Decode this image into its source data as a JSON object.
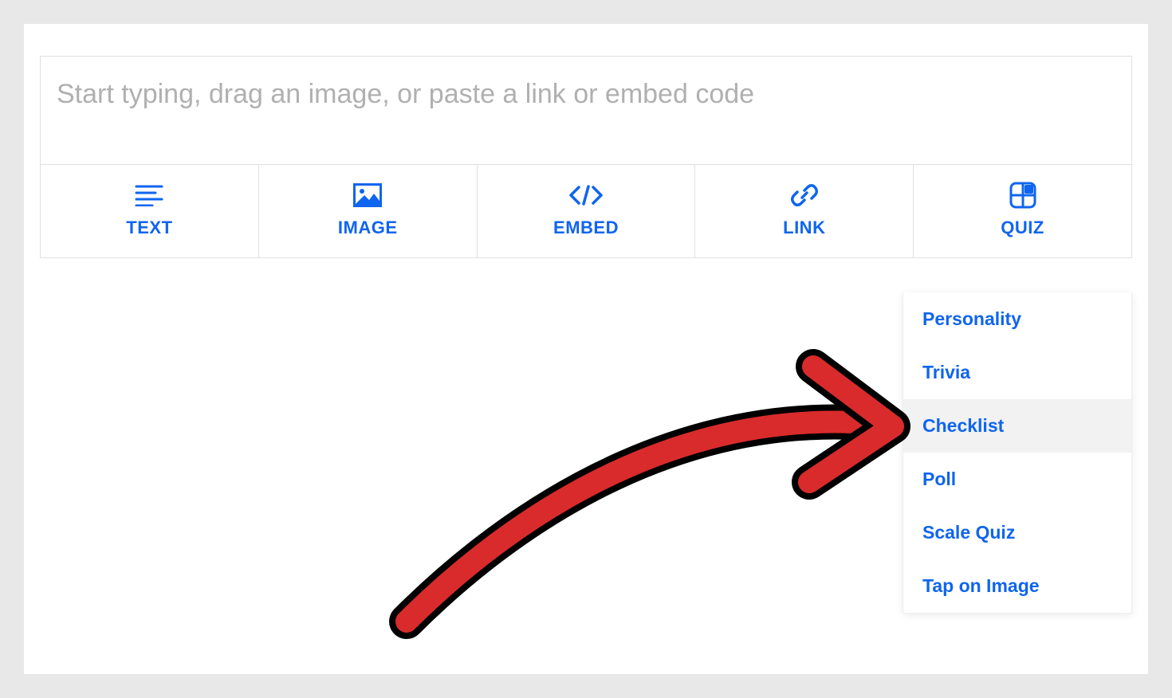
{
  "editor": {
    "placeholder": "Start typing, drag an image, or paste a link or embed code",
    "value": ""
  },
  "toolbar": {
    "text": {
      "label": "TEXT"
    },
    "image": {
      "label": "IMAGE"
    },
    "embed": {
      "label": "EMBED"
    },
    "link": {
      "label": "LINK"
    },
    "quiz": {
      "label": "QUIZ"
    }
  },
  "quiz_dropdown": {
    "items": [
      {
        "label": "Personality",
        "highlight": false
      },
      {
        "label": "Trivia",
        "highlight": false
      },
      {
        "label": "Checklist",
        "highlight": true
      },
      {
        "label": "Poll",
        "highlight": false
      },
      {
        "label": "Scale Quiz",
        "highlight": false
      },
      {
        "label": "Tap on Image",
        "highlight": false
      }
    ]
  },
  "colors": {
    "accent": "#0f65ef",
    "arrow": "#d92b2b"
  }
}
